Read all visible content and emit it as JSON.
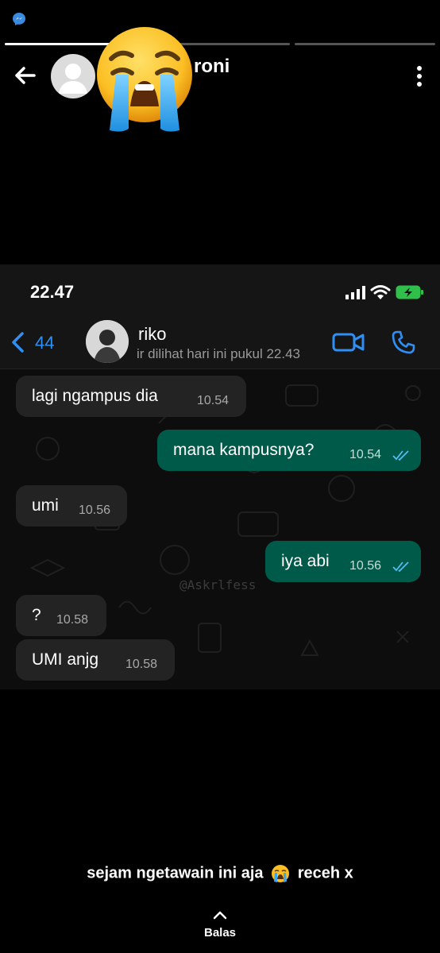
{
  "story": {
    "username": "roni",
    "progress_bars": [
      1.0,
      0.0,
      0.0
    ]
  },
  "chat": {
    "time": "22.47",
    "back_count": "44",
    "contact_name": "riko",
    "last_seen": "ir dilihat hari ini pukul 22.43",
    "watermark": "@Askrlfess",
    "messages": [
      {
        "text": "lagi ngampus dia",
        "time": "10.54",
        "side": "in"
      },
      {
        "text": "mana kampusnya?",
        "time": "10.54",
        "side": "out"
      },
      {
        "text": "umi",
        "time": "10.56",
        "side": "in"
      },
      {
        "text": "iya abi",
        "time": "10.56",
        "side": "out"
      },
      {
        "text": "?",
        "time": "10.58",
        "side": "in"
      },
      {
        "text": "UMI anjg",
        "time": "10.58",
        "side": "in"
      }
    ]
  },
  "caption": {
    "before": "sejam ngetawain ini aja",
    "after": "receh x"
  },
  "reply": {
    "label": "Balas"
  },
  "colors": {
    "accent_blue": "#2f8ff2",
    "outgoing_bubble": "#005a4a",
    "incoming_bubble": "#232323",
    "tick_blue": "#53bdeb"
  },
  "icons": [
    "messenger-icon",
    "back-arrow-icon",
    "loudly-crying-face-icon",
    "more-vertical-icon",
    "signal-icon",
    "wifi-icon",
    "battery-charging-icon",
    "video-call-icon",
    "phone-icon",
    "double-check-icon",
    "chevron-up-icon"
  ]
}
